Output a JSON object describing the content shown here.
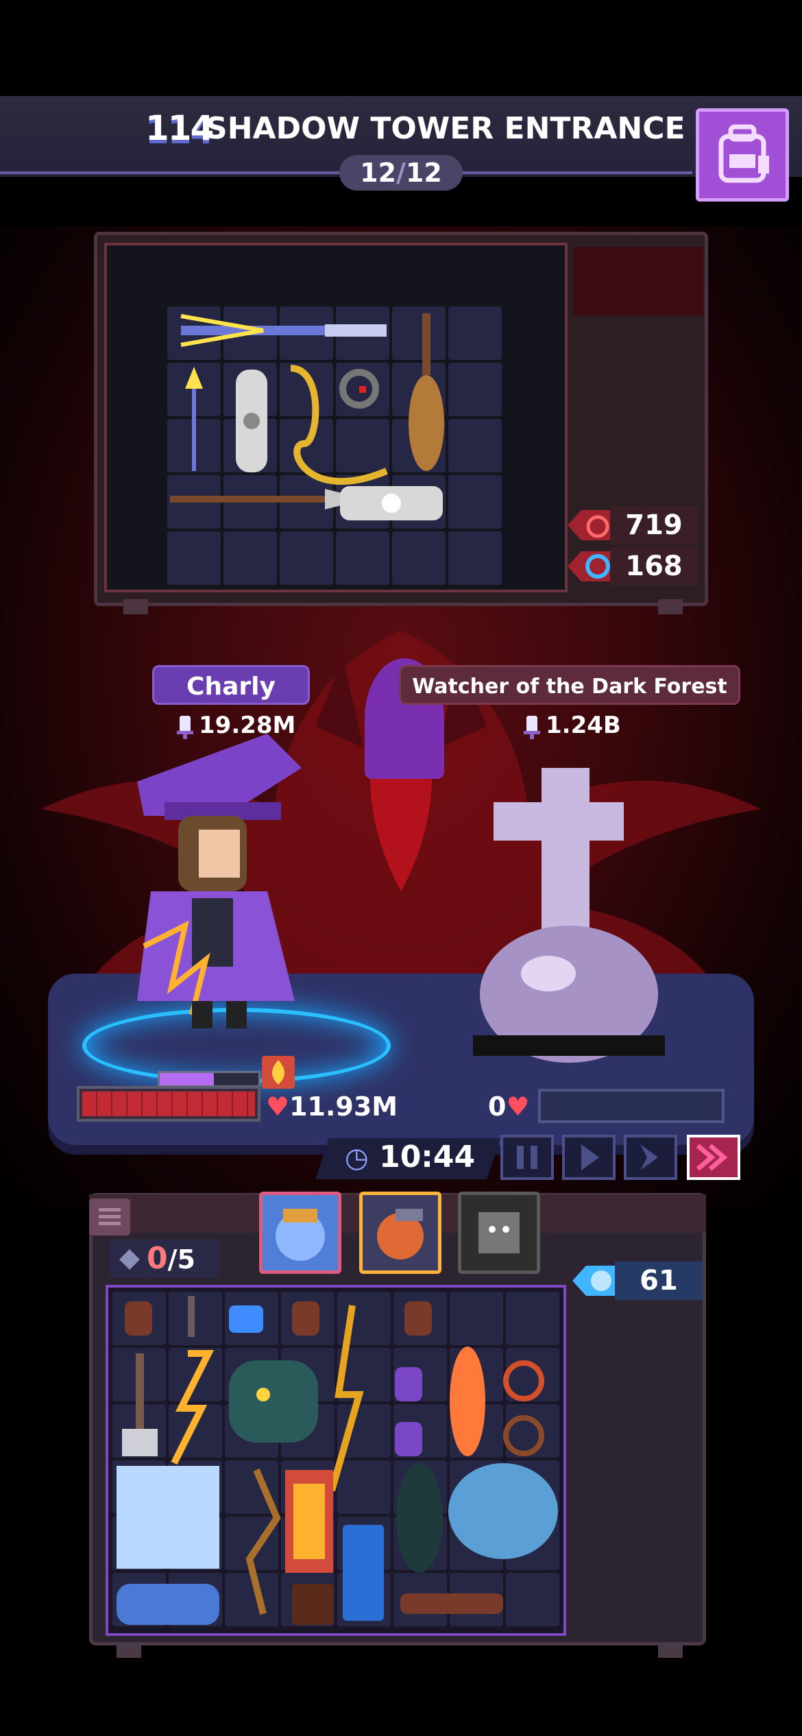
{
  "header": {
    "level": "114",
    "title": "SHADOW TOWER ENTRANCE",
    "stage_current": "12",
    "stage_separator": "/",
    "stage_total": "12",
    "backpack_icon": "backpack-icon"
  },
  "stats": {
    "attack_value": "719",
    "defense_value": "168",
    "gems_value": "61"
  },
  "hero": {
    "name": "Charly",
    "power": "19.28M",
    "hp": "11.93M",
    "shield_fraction": 0.55
  },
  "enemy": {
    "name": "Watcher of the Dark Forest",
    "power": "1.24B",
    "hp": "0",
    "hp_fraction": 0
  },
  "battle": {
    "timer": "10:44",
    "controls": [
      "pause",
      "play",
      "speed-2x",
      "speed-3x"
    ]
  },
  "bag": {
    "slots_used": "0",
    "slots_total": "/5"
  },
  "colors": {
    "accent_purple": "#a14fd6",
    "hp_red": "#c22a34",
    "enemy_panel": "#5e2b3d",
    "gem_blue": "#3fb6ff"
  }
}
